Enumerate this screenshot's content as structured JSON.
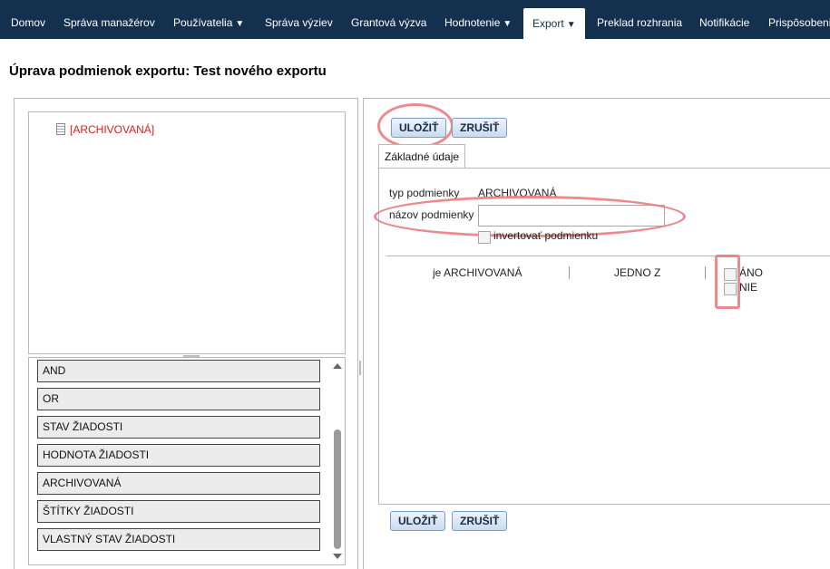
{
  "nav": {
    "items": [
      {
        "label": "Domov",
        "caret": ""
      },
      {
        "label": "Správa manažérov",
        "caret": ""
      },
      {
        "label": "Používatelia",
        "caret": "▼"
      },
      {
        "label": "Správa výziev",
        "caret": ""
      },
      {
        "label": "Grantová výzva",
        "caret": ""
      },
      {
        "label": "Hodnotenie",
        "caret": "▼"
      },
      {
        "label": "Export",
        "caret": "▼"
      },
      {
        "label": "Preklad rozhrania",
        "caret": ""
      },
      {
        "label": "Notifikácie",
        "caret": ""
      },
      {
        "label": "Prispôsobenie",
        "caret": ""
      }
    ],
    "active": "Export"
  },
  "page": {
    "title": "Úprava podmienok exportu: Test nového exportu"
  },
  "tree": {
    "node_label": "[ARCHIVOVANÁ]",
    "node_icon": "document-icon"
  },
  "operators": [
    "AND",
    "OR",
    "STAV ŽIADOSTI",
    "HODNOTA ŽIADOSTI",
    "ARCHIVOVANÁ",
    "ŠTÍTKY ŽIADOSTI",
    "VLASTNÝ STAV ŽIADOSTI"
  ],
  "toolbar": {
    "save_label": "ULOŽIŤ",
    "cancel_label": "ZRUŠIŤ"
  },
  "form": {
    "tab_label": "Základné údaje",
    "type_label": "typ podmienky",
    "type_value": "ARCHIVOVANÁ",
    "name_label": "názov podmienky",
    "name_value": "",
    "invert_label": "invertovať podmienku"
  },
  "condition_row": {
    "field": "je ARCHIVOVANÁ",
    "operator": "JEDNO Z",
    "options": [
      "ÁNO",
      "NIE"
    ]
  },
  "colors": {
    "nav_bg": "#14304f",
    "highlight": "#e9767a",
    "archived_red": "#d8231c"
  }
}
